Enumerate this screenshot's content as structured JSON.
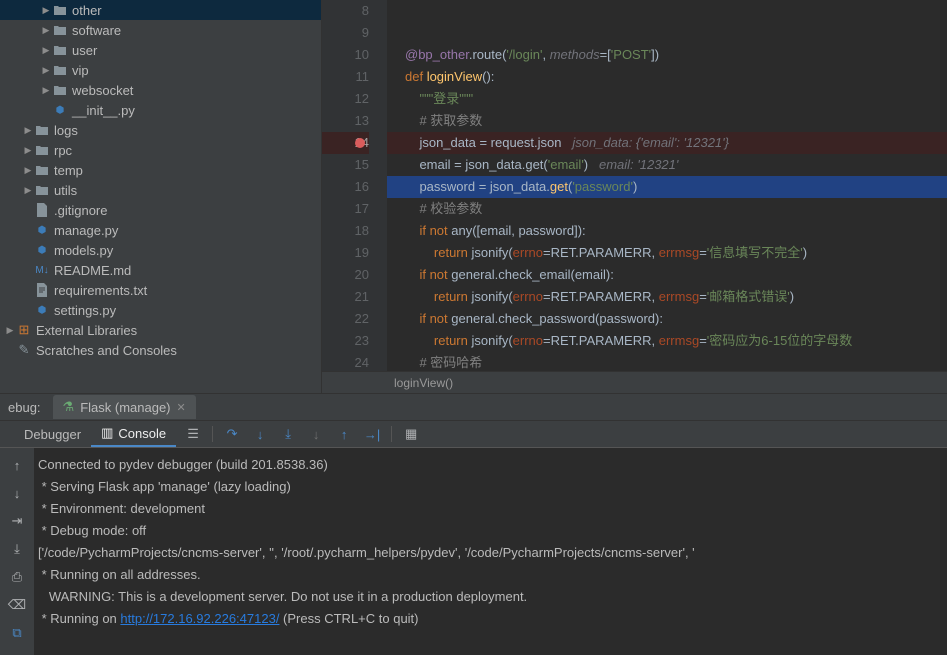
{
  "sidebar": {
    "items": [
      {
        "indent": 2,
        "chev": "▶",
        "icon": "folder",
        "label": "other",
        "selected": true
      },
      {
        "indent": 2,
        "chev": "▶",
        "icon": "folder",
        "label": "software"
      },
      {
        "indent": 2,
        "chev": "▶",
        "icon": "folder",
        "label": "user"
      },
      {
        "indent": 2,
        "chev": "▶",
        "icon": "folder",
        "label": "vip"
      },
      {
        "indent": 2,
        "chev": "▶",
        "icon": "folder",
        "label": "websocket"
      },
      {
        "indent": 2,
        "chev": "",
        "icon": "py",
        "label": "__init__.py"
      },
      {
        "indent": 1,
        "chev": "▶",
        "icon": "folder",
        "label": "logs"
      },
      {
        "indent": 1,
        "chev": "▶",
        "icon": "folder",
        "label": "rpc"
      },
      {
        "indent": 1,
        "chev": "▶",
        "icon": "folder",
        "label": "temp"
      },
      {
        "indent": 1,
        "chev": "▶",
        "icon": "folder",
        "label": "utils"
      },
      {
        "indent": 1,
        "chev": "",
        "icon": "file",
        "label": ".gitignore"
      },
      {
        "indent": 1,
        "chev": "",
        "icon": "py",
        "label": "manage.py"
      },
      {
        "indent": 1,
        "chev": "",
        "icon": "py",
        "label": "models.py"
      },
      {
        "indent": 1,
        "chev": "",
        "icon": "md",
        "label": "README.md"
      },
      {
        "indent": 1,
        "chev": "",
        "icon": "txt",
        "label": "requirements.txt"
      },
      {
        "indent": 1,
        "chev": "",
        "icon": "py",
        "label": "settings.py"
      },
      {
        "indent": 0,
        "chev": "▶",
        "icon": "lib",
        "label": "External Libraries"
      },
      {
        "indent": 0,
        "chev": "",
        "icon": "scratch",
        "label": "Scratches and Consoles"
      }
    ]
  },
  "editor": {
    "startLine": 8,
    "breakpointLine": 14,
    "execLine": 16,
    "breadcrumb": "loginView()",
    "lines": [
      {
        "n": 8,
        "html": ""
      },
      {
        "n": 9,
        "html": ""
      },
      {
        "n": 10,
        "html": "<span class='d'>@bp_other</span><span class='n'>.</span><span class='n'>route</span><span class='n'>(</span><span class='s'>'/login'</span><span class='n'>, </span><span class='hint'>methods</span><span class='n'>=[</span><span class='s'>'POST'</span><span class='n'>])</span>"
      },
      {
        "n": 11,
        "html": "<span class='k'>def </span><span class='fn'>loginView</span><span class='n'>():</span>"
      },
      {
        "n": 12,
        "html": "    <span class='s'>\"\"\"登录\"\"\"</span>"
      },
      {
        "n": 13,
        "html": "    <span class='c'># 获取参数</span>"
      },
      {
        "n": 14,
        "html": "    <span class='n'>json_data </span><span class='op'>=</span><span class='n'> request.json   </span><span class='hint'>json_data: {'email': '12321'}</span>",
        "bp": true
      },
      {
        "n": 15,
        "html": "    <span class='n'>email </span><span class='op'>=</span><span class='n'> json_data.</span><span class='n'>get</span><span class='n'>(</span><span class='s'>'email'</span><span class='n'>)   </span><span class='hint'>email: '12321'</span>"
      },
      {
        "n": 16,
        "html": "    <span class='n'>password </span><span class='op'>=</span><span class='n'> json_data.</span><span class='y'>get</span><span class='n'>(</span><span class='s'>'password'</span><span class='n'>)</span>",
        "exec": true
      },
      {
        "n": 17,
        "html": "    <span class='c'># 校验参数</span>"
      },
      {
        "n": 18,
        "html": "    <span class='k'>if not </span><span class='n'>any([email</span><span class='n'>, </span><span class='n'>password]):</span>"
      },
      {
        "n": 19,
        "html": "        <span class='k'>return </span><span class='n'>jsonify(</span><span class='kw-arg'>errno</span><span class='n'>=RET.PARAMERR</span><span class='n'>, </span><span class='kw-arg'>errmsg</span><span class='n'>=</span><span class='s'>'信息填写不完全'</span><span class='n'>)</span>"
      },
      {
        "n": 20,
        "html": "    <span class='k'>if not </span><span class='n'>general.check_email(email):</span>"
      },
      {
        "n": 21,
        "html": "        <span class='k'>return </span><span class='n'>jsonify(</span><span class='kw-arg'>errno</span><span class='n'>=RET.PARAMERR</span><span class='n'>, </span><span class='kw-arg'>errmsg</span><span class='n'>=</span><span class='s'>'邮箱格式错误'</span><span class='n'>)</span>"
      },
      {
        "n": 22,
        "html": "    <span class='k'>if not </span><span class='n'>general.check_password(password):</span>"
      },
      {
        "n": 23,
        "html": "        <span class='k'>return </span><span class='n'>jsonify(</span><span class='kw-arg'>errno</span><span class='n'>=RET.PARAMERR</span><span class='n'>, </span><span class='kw-arg'>errmsg</span><span class='n'>=</span><span class='s'>'密码应为6-15位的字母数</span>"
      },
      {
        "n": 24,
        "html": "    <span class='c'># 密码哈希</span>"
      }
    ]
  },
  "debug": {
    "panelLabel": "ebug:",
    "runConfig": "Flask (manage)",
    "tabs": {
      "debugger": "Debugger",
      "console": "Console"
    }
  },
  "console": {
    "lines": [
      "Connected to pydev debugger (build 201.8538.36)",
      " * Serving Flask app 'manage' (lazy loading)",
      " * Environment: development",
      " * Debug mode: off",
      "['/code/PycharmProjects/cncms-server', '', '/root/.pycharm_helpers/pydev', '/code/PycharmProjects/cncms-server', '",
      " * Running on all addresses.",
      "   WARNING: This is a development server. Do not use it in a production deployment.",
      " * Running on <a>http://172.16.92.226:47123/</a> (Press CTRL+C to quit)"
    ]
  }
}
